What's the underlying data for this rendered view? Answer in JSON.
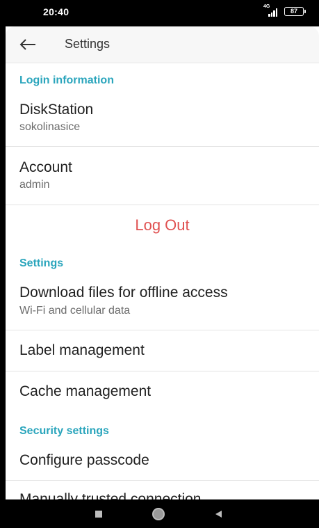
{
  "status_bar": {
    "time": "20:40",
    "network": "4G",
    "battery": "87"
  },
  "toolbar": {
    "title": "Settings"
  },
  "sections": {
    "login": {
      "header": "Login information",
      "diskstation": {
        "title": "DiskStation",
        "value": "sokolinasice"
      },
      "account": {
        "title": "Account",
        "value": "admin"
      },
      "logout": "Log Out"
    },
    "settings": {
      "header": "Settings",
      "download": {
        "title": "Download files for offline access",
        "value": "Wi-Fi and cellular data"
      },
      "label_management": "Label management",
      "cache_management": "Cache management"
    },
    "security": {
      "header": "Security settings",
      "passcode": "Configure passcode",
      "trusted": "Manually trusted connection"
    }
  },
  "colors": {
    "accent": "#2aa5bc",
    "danger": "#e05252"
  },
  "icons": {
    "back": "arrow-left-icon",
    "nav_recent": "square-icon",
    "nav_home": "circle-icon",
    "nav_back": "triangle-back-icon"
  }
}
